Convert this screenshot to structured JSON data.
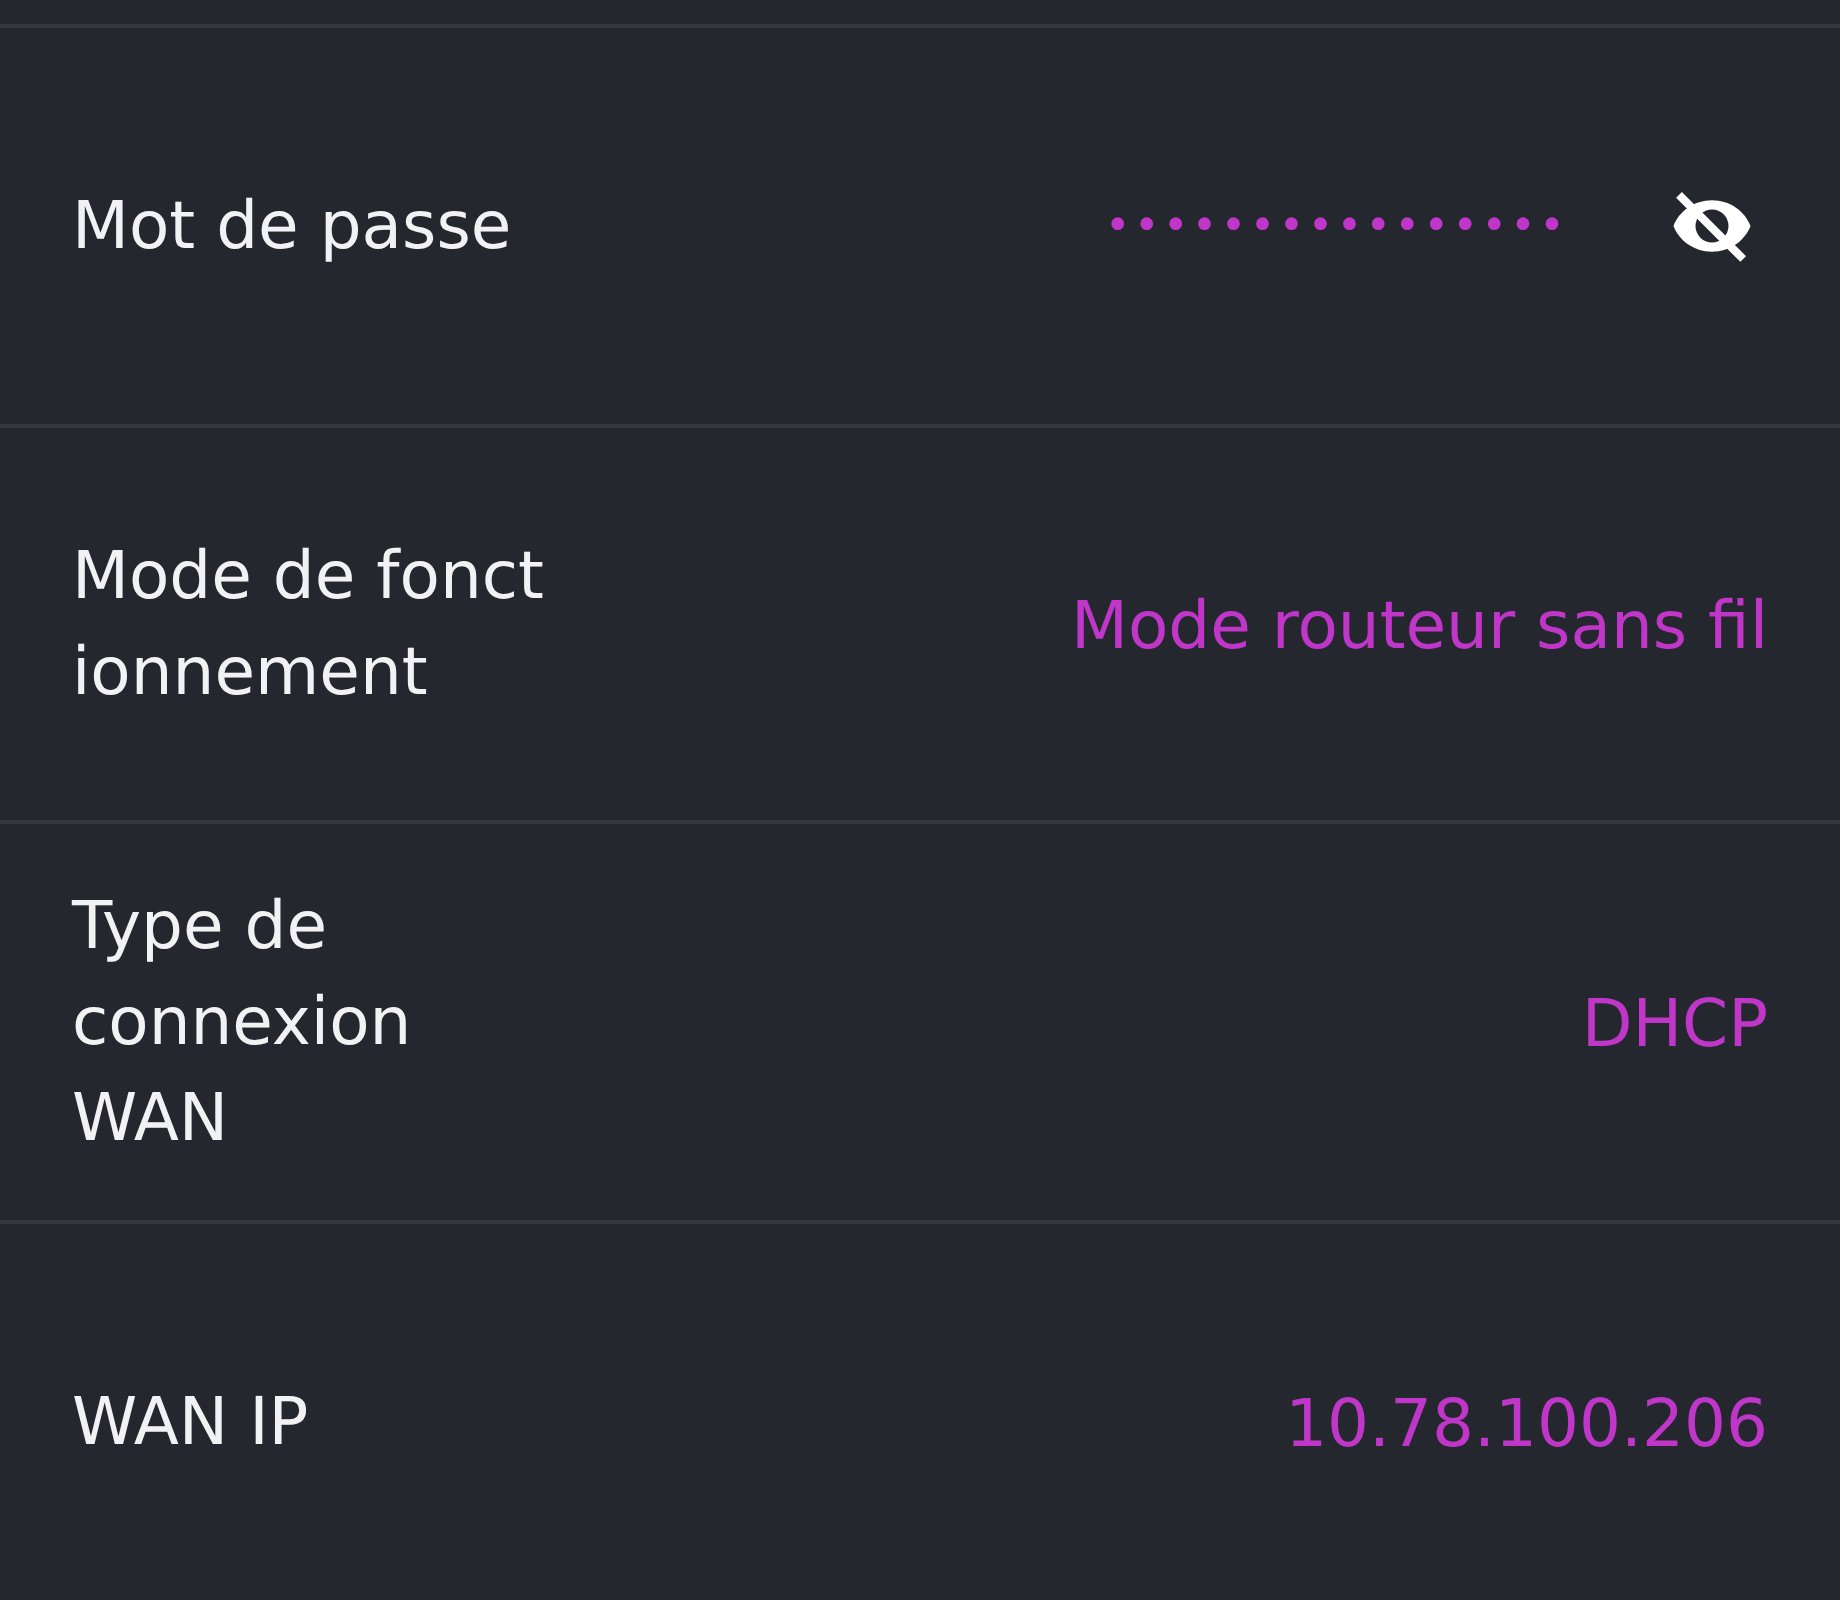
{
  "rows": [
    {
      "kind": "password",
      "label": "Mot de passe",
      "value": "••••••••••••••••",
      "revealed": false
    },
    {
      "kind": "text",
      "label": "Mode de fonct\nionnement",
      "value": "Mode routeur sans fil"
    },
    {
      "kind": "text",
      "label": "Type de\nconnexion\nWAN",
      "value": "DHCP"
    },
    {
      "kind": "text",
      "label": "WAN IP",
      "value": "10.78.100.206"
    }
  ]
}
